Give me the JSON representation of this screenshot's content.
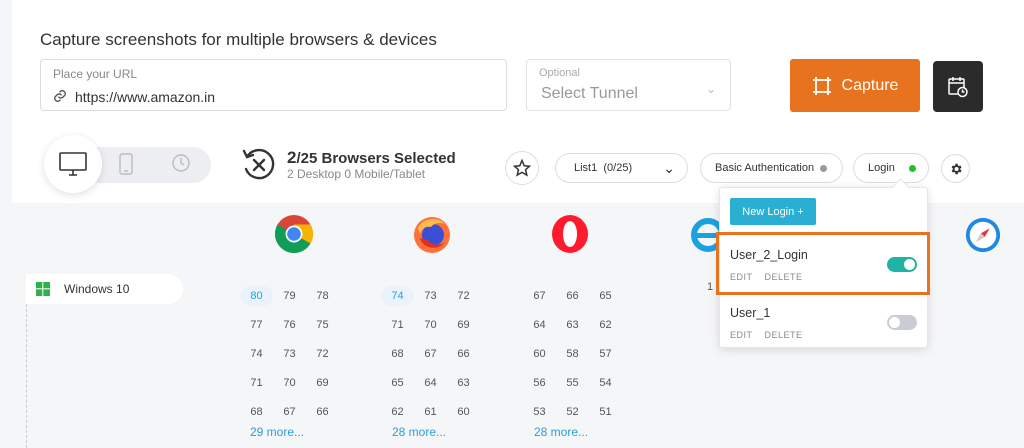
{
  "header": {
    "title": "Capture screenshots for multiple browsers & devices"
  },
  "url": {
    "label": "Place your URL",
    "value": "https://www.amazon.in",
    "icon": "link-icon"
  },
  "tunnel": {
    "label": "Optional",
    "value": "Select Tunnel"
  },
  "capture": {
    "label": "Capture",
    "color": "#e8731f"
  },
  "selection": {
    "count": "2",
    "total": "/25 Browsers Selected",
    "subtitle": "2 Desktop 0 Mobile/Tablet"
  },
  "toolbar": {
    "list_name": "List1",
    "list_count": "(0/25)",
    "auth_label": "Basic Authentication",
    "auth_status_color": "#999999",
    "login_label": "Login",
    "login_status_color": "#22c02a"
  },
  "os": {
    "label": "Windows 10"
  },
  "browsers": [
    {
      "name": "Chrome",
      "versions": [
        [
          "80",
          "79",
          "78"
        ],
        [
          "77",
          "76",
          "75"
        ],
        [
          "74",
          "73",
          "72"
        ],
        [
          "71",
          "70",
          "69"
        ],
        [
          "68",
          "67",
          "66"
        ]
      ],
      "selected": "80",
      "more": "29 more..."
    },
    {
      "name": "Firefox",
      "versions": [
        [
          "74",
          "73",
          "72"
        ],
        [
          "71",
          "70",
          "69"
        ],
        [
          "68",
          "67",
          "66"
        ],
        [
          "65",
          "64",
          "63"
        ],
        [
          "62",
          "61",
          "60"
        ]
      ],
      "selected": "74",
      "more": "28 more..."
    },
    {
      "name": "Opera",
      "versions": [
        [
          "67",
          "66",
          "65"
        ],
        [
          "64",
          "63",
          "62"
        ],
        [
          "60",
          "58",
          "57"
        ],
        [
          "56",
          "55",
          "54"
        ],
        [
          "53",
          "52",
          "51"
        ]
      ],
      "selected": "",
      "more": "28 more..."
    }
  ],
  "ie_partial": "1",
  "login_popup": {
    "new_button": "New Login +",
    "items": [
      {
        "name": "User_2_Login",
        "edit": "EDIT",
        "delete": "DELETE",
        "enabled": true
      },
      {
        "name": "User_1",
        "edit": "EDIT",
        "delete": "DELETE",
        "enabled": false
      }
    ],
    "toggle_on_color": "#1fb3a6",
    "toggle_off_color": "#c9ccd4"
  }
}
